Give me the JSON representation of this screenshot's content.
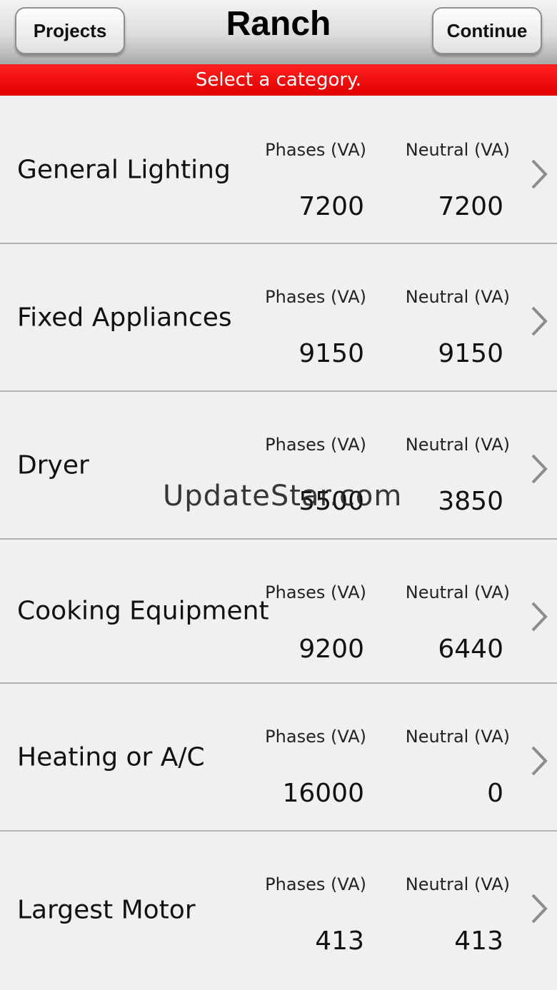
{
  "header": {
    "title": "Ranch",
    "left_button": "Projects",
    "right_button": "Continue"
  },
  "banner": {
    "text": "Select a category."
  },
  "categories": [
    {
      "name": "General Lighting",
      "phases_label": "Phases (VA)",
      "neutral_label": "Neutral (VA)",
      "phases": "7200",
      "neutral": "7200"
    },
    {
      "name": "Fixed Appliances",
      "phases_label": "Phases (VA)",
      "neutral_label": "Neutral (VA)",
      "phases": "9150",
      "neutral": "9150"
    },
    {
      "name": "Dryer",
      "phases_label": "Phases (VA)",
      "neutral_label": "Neutral (VA)",
      "phases": "5500",
      "neutral": "3850"
    },
    {
      "name": "Cooking Equipment",
      "phases_label": "Phases (VA)",
      "neutral_label": "Neutral (VA)",
      "phases": "9200",
      "neutral": "6440"
    },
    {
      "name": "Heating or A/C",
      "phases_label": "Phases (VA)",
      "neutral_label": "Neutral (VA)",
      "phases": "16000",
      "neutral": "0"
    },
    {
      "name": "Largest Motor",
      "phases_label": "Phases (VA)",
      "neutral_label": "Neutral (VA)",
      "phases": "413",
      "neutral": "413"
    }
  ],
  "watermark": "UpdateStar.com",
  "colors": {
    "banner": "#e00000",
    "background": "#f0f0f0",
    "divider": "#b4b4b4"
  },
  "icons": {
    "row_disclosure": "chevron-right-icon"
  }
}
